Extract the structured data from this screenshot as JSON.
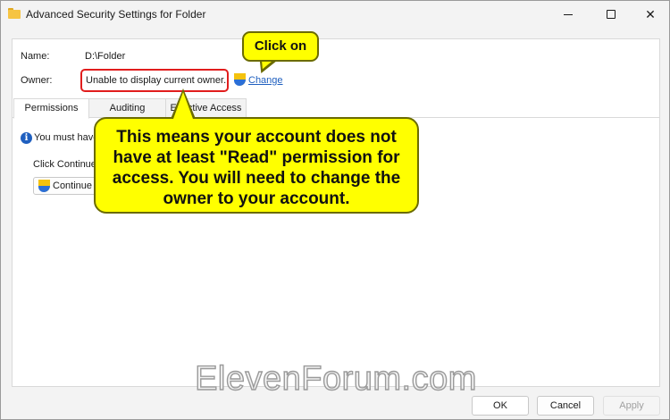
{
  "window": {
    "title": "Advanced Security Settings for Folder"
  },
  "fields": {
    "name_label": "Name:",
    "name_value": "D:\\Folder",
    "owner_label": "Owner:",
    "owner_value": "Unable to display current owner.",
    "change_link": "Change"
  },
  "tabs": [
    {
      "label": "Permissions"
    },
    {
      "label": "Auditing"
    },
    {
      "label": "Effective Access"
    }
  ],
  "permissions": {
    "info_text": "You must have",
    "click_text": "Click Continue",
    "continue_button": "Continue"
  },
  "callouts": {
    "small": "Click on",
    "big": "This means your account does not have at least \"Read\" permission for access. You will need to change the owner to your account."
  },
  "watermark": "ElevenForum.com",
  "buttons": {
    "ok": "OK",
    "cancel": "Cancel",
    "apply": "Apply"
  },
  "colors": {
    "highlight": "#e11d1d",
    "callout": "#ffff00",
    "link": "#1f5fbf"
  },
  "icons": {
    "folder": "folder-icon",
    "shield": "uac-shield-icon",
    "info": "info-icon"
  }
}
